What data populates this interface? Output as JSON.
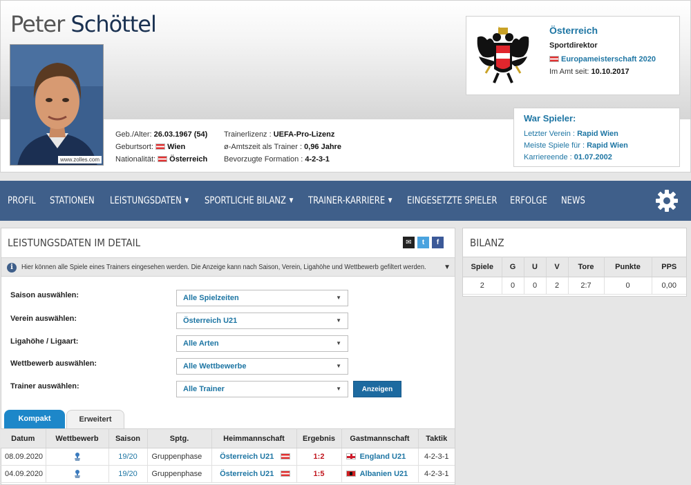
{
  "header": {
    "first_name": "Peter",
    "last_name": "Schöttel",
    "photo_credit": "www.zolles.com",
    "facts_left": [
      {
        "label": "Geb./Alter:",
        "value": "26.03.1967 (54)"
      },
      {
        "label": "Geburtsort:",
        "value": "Wien",
        "flag": "austria-flag-icon"
      },
      {
        "label": "Nationalität:",
        "value": "Österreich",
        "flag": "austria-flag-icon"
      }
    ],
    "facts_right": [
      {
        "label": "Trainerlizenz :",
        "value": "UEFA-Pro-Lizenz"
      },
      {
        "label": "ø-Amtszeit als Trainer :",
        "value": "0,96 Jahre"
      },
      {
        "label": "Bevorzugte Formation :",
        "value": "4-2-3-1"
      }
    ],
    "current_club": {
      "name": "Österreich",
      "role": "Sportdirektor",
      "competition": "Europameisterschaft 2020",
      "since_label": "Im Amt seit:",
      "since_value": "10.10.2017",
      "crest_icon": "austrian-eagle-crest-icon"
    },
    "former_player": {
      "title": "War Spieler:",
      "rows": [
        {
          "label": "Letzter Verein :",
          "value": "Rapid Wien"
        },
        {
          "label": "Meiste Spiele für :",
          "value": "Rapid Wien"
        },
        {
          "label": "Karriereende :",
          "value": "01.07.2002"
        }
      ]
    }
  },
  "nav": {
    "items": [
      {
        "label": "Profil",
        "caret": false
      },
      {
        "label": "Stationen",
        "caret": false
      },
      {
        "label": "Leistungsdaten",
        "caret": true
      },
      {
        "label": "Sportliche Bilanz",
        "caret": true
      },
      {
        "label": "Trainer-Karriere",
        "caret": true
      },
      {
        "label": "Eingesetzte Spieler",
        "caret": false
      },
      {
        "label": "Erfolge",
        "caret": false
      },
      {
        "label": "News",
        "caret": false
      }
    ],
    "settings_icon": "gear-icon"
  },
  "main": {
    "title": "Leistungsdaten im Detail",
    "share_icons": [
      "email-icon",
      "twitter-icon",
      "facebook-icon"
    ],
    "info_text": "Hier können alle Spiele eines Trainers eingesehen werden. Die Anzeige kann nach Saison, Verein, Ligahöhe und Wettbewerb gefiltert werden.",
    "filters": [
      {
        "label": "Saison auswählen:",
        "value": "Alle Spielzeiten"
      },
      {
        "label": "Verein auswählen:",
        "value": "Österreich U21"
      },
      {
        "label": "Ligahöhe / Ligaart:",
        "value": "Alle Arten"
      },
      {
        "label": "Wettbewerb auswählen:",
        "value": "Alle Wettbewerbe"
      },
      {
        "label": "Trainer auswählen:",
        "value": "Alle Trainer"
      }
    ],
    "show_button": "Anzeigen",
    "tabs": [
      "Kompakt",
      "Erweitert"
    ],
    "table": {
      "headers": [
        "Datum",
        "Wettbewerb",
        "Saison",
        "Sptg.",
        "Heimmannschaft",
        "Ergebnis",
        "Gastmannschaft",
        "Taktik"
      ],
      "rows": [
        {
          "date": "08.09.2020",
          "season": "19/20",
          "matchday": "Gruppenphase",
          "home": "Österreich U21",
          "home_flag": "austria-flag-icon",
          "result": "1:2",
          "away": "England U21",
          "away_flag": "england-flag-icon",
          "tactic": "4-2-3-1"
        },
        {
          "date": "04.09.2020",
          "season": "19/20",
          "matchday": "Gruppenphase",
          "home": "Österreich U21",
          "home_flag": "austria-flag-icon",
          "result": "1:5",
          "away": "Albanien U21",
          "away_flag": "albania-flag-icon",
          "tactic": "4-2-3-1"
        }
      ]
    }
  },
  "bilanz": {
    "title": "Bilanz",
    "headers": [
      "Spiele",
      "G",
      "U",
      "V",
      "Tore",
      "Punkte",
      "PPS"
    ],
    "values": [
      "2",
      "0",
      "0",
      "2",
      "2:7",
      "0",
      "0,00"
    ]
  },
  "colors": {
    "nav_bg": "#3f5f8a",
    "link": "#1d75a3",
    "tab_active": "#1d87c9",
    "score": "#c0141c"
  }
}
